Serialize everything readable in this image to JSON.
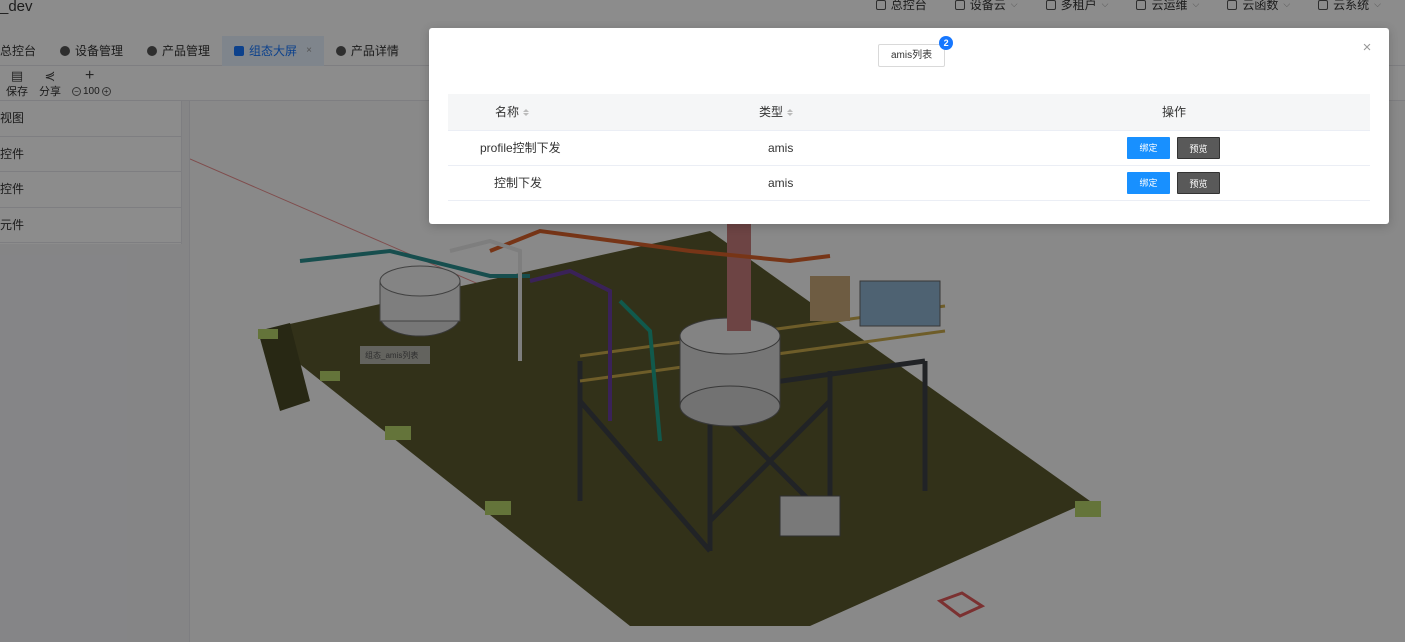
{
  "app": {
    "title": "_dev"
  },
  "topnav": [
    {
      "label": "总控台",
      "icon": "home-icon"
    },
    {
      "label": "设备云",
      "icon": "device-icon"
    },
    {
      "label": "多租户",
      "icon": "users-icon"
    },
    {
      "label": "云运维",
      "icon": "ops-icon"
    },
    {
      "label": "云函数",
      "icon": "cloud-icon"
    },
    {
      "label": "云系统",
      "icon": "system-icon"
    }
  ],
  "tabs": [
    {
      "label": "总控台"
    },
    {
      "label": "设备管理"
    },
    {
      "label": "产品管理"
    },
    {
      "label": "组态大屏",
      "active": true
    },
    {
      "label": "产品详情"
    }
  ],
  "toolbar": {
    "save": "保存",
    "share": "分享",
    "zoom": "100"
  },
  "sidebar": {
    "items": [
      "视图",
      "控件",
      "控件",
      "元件"
    ]
  },
  "canvas": {
    "overlay_label": "组态_amis列表"
  },
  "modal": {
    "pill_label": "amis列表",
    "badge_count": "2",
    "close_icon": "×",
    "columns": {
      "name": "名称",
      "type": "类型",
      "action": "操作"
    },
    "rows": [
      {
        "name": "profile控制下发",
        "type": "amis",
        "bind": "绑定",
        "preview": "预览"
      },
      {
        "name": "控制下发",
        "type": "amis",
        "bind": "绑定",
        "preview": "预览"
      }
    ]
  },
  "colors": {
    "primary": "#1890ff",
    "preview_btn": "#595959",
    "mask": "rgba(0,0,0,0.45)"
  }
}
